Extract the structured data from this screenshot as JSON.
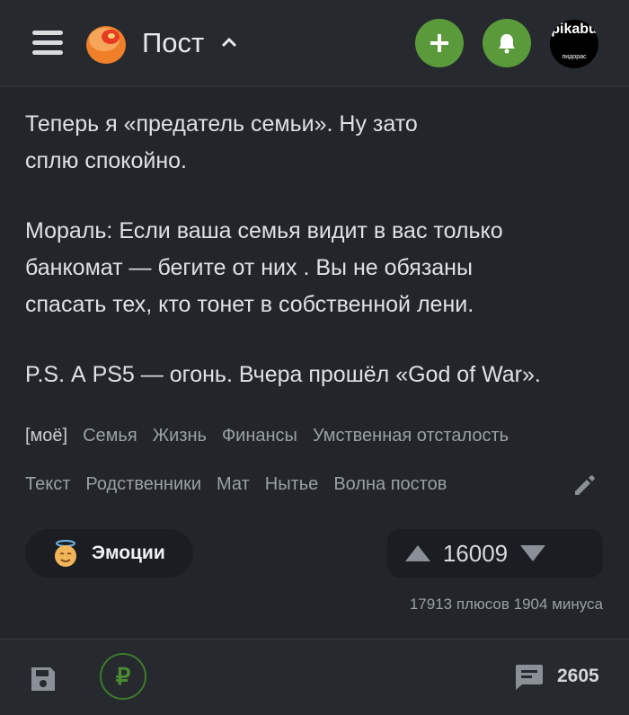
{
  "header": {
    "title": "Пост",
    "avatar_text": "pikabu",
    "avatar_subtext": "пидорас"
  },
  "post": {
    "paragraphs": [
      [
        "Теперь я «предатель семьи». Ну зато",
        "сплю спокойно."
      ],
      [
        "Мораль: Если ваша семья видит в вас только",
        "банкомат — бегите от них . Вы не обязаны",
        "спасать тех, кто тонет в собственной лени."
      ],
      [
        "P.S. А PS5 — огонь. Вчера прошёл «God of War»."
      ]
    ]
  },
  "tags": {
    "row1": [
      "[моё]",
      "Семья",
      "Жизнь",
      "Финансы",
      "Умственная отсталость"
    ],
    "row2": [
      "Текст",
      "Родственники",
      "Мат",
      "Нытье",
      "Волна постов"
    ]
  },
  "emotions": {
    "label": "Эмоции"
  },
  "rating": {
    "score": "16009",
    "votes_summary": "17913 плюсов 1904 минуса"
  },
  "bottom": {
    "comments_count": "2605",
    "donate_symbol": "₽"
  },
  "colors": {
    "background": "#22262b",
    "bar": "#262a2f",
    "accent_green": "#5a9a3a",
    "muted_text": "#9aa0a6"
  }
}
